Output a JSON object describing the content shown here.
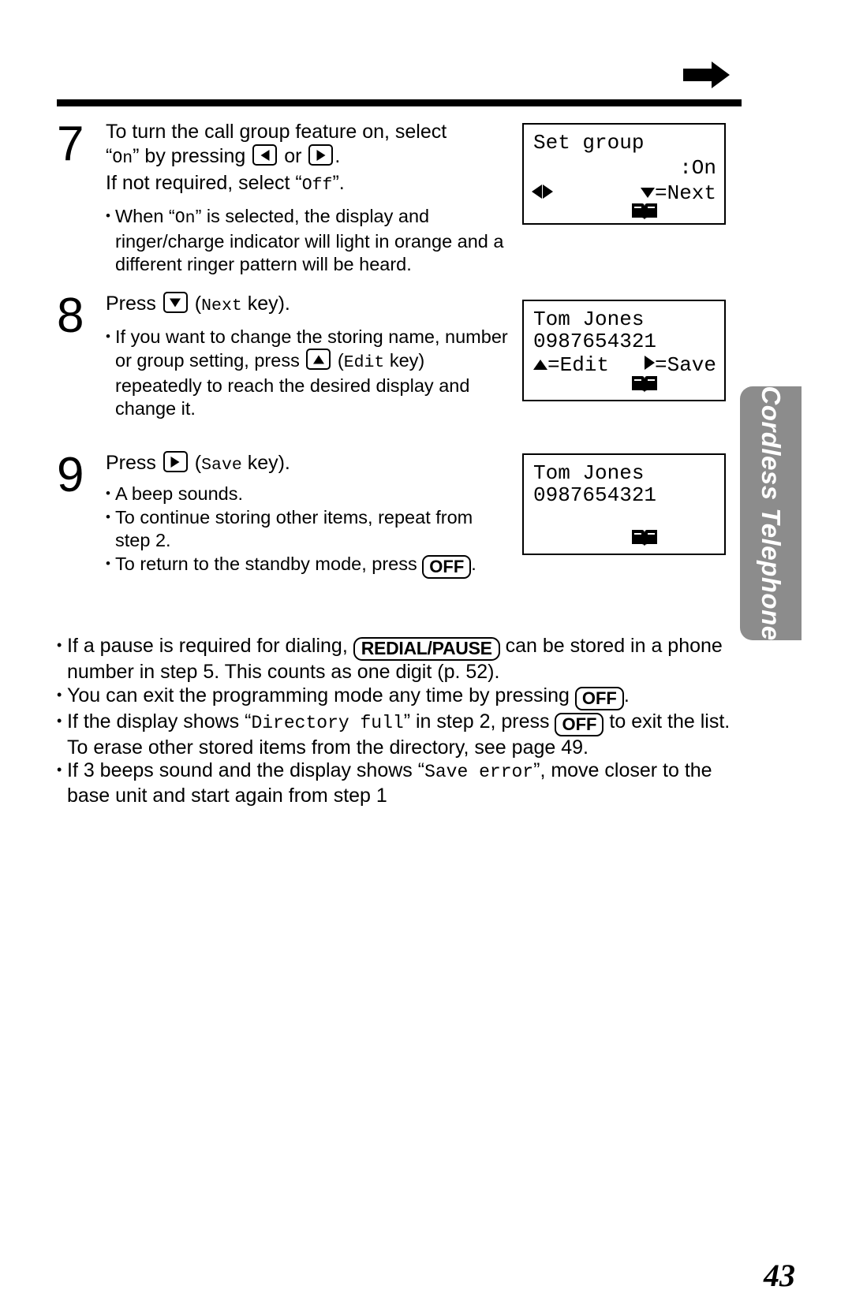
{
  "document": {
    "page_number": "43",
    "side_tab_label": "Cordless Telephone",
    "header_arrow_icon": "right-arrow-icon"
  },
  "steps": [
    {
      "number": "7",
      "lead_part1": "To turn the call group feature on, select",
      "lead_quote_on": "On",
      "lead_part2": "by pressing",
      "lead_or": "or",
      "lead_part3": "If not required, select",
      "lead_quote_off": "Off",
      "bullets": [
        {
          "pre": "When",
          "quoted": "On",
          "post": "is selected, the display and ringer/charge indicator will light in orange and a different ringer pattern will be heard."
        }
      ],
      "keys": [
        "left-arrow-key",
        "right-arrow-key"
      ]
    },
    {
      "number": "8",
      "lead_part1": "Press",
      "lead_key_label": "Next",
      "lead_part2": "key).",
      "bullets": [
        {
          "pre": "If you want to change the storing name, number or group setting, press",
          "key_label": "Edit",
          "post": "key) repeatedly to reach the desired display and change it."
        }
      ],
      "keys": [
        "down-arrow-key",
        "up-arrow-key"
      ]
    },
    {
      "number": "9",
      "lead_part1": "Press",
      "lead_key_label": "Save",
      "lead_part2": "key).",
      "bullets": [
        {
          "text": "A beep sounds."
        },
        {
          "text": "To continue storing other items, repeat from step 2."
        },
        {
          "pre": "To return to the standby mode, press",
          "key_label": "OFF",
          "post": "."
        }
      ],
      "keys": [
        "right-arrow-key"
      ]
    }
  ],
  "lcd_screens": [
    {
      "id": "set-group-screen",
      "line1": "Set group",
      "line2_right": ":On",
      "line3_right": "=Next",
      "left_right_arrows": "left-right-arrows-icon",
      "down_arrow": "down-triangle-icon",
      "book_icon": "open-book-icon"
    },
    {
      "id": "tom-jones-edit-screen",
      "line1": "Tom Jones",
      "line2": "0987654321",
      "line3_left": "=Edit",
      "line3_right": "=Save",
      "up_arrow": "up-triangle-icon",
      "right_arrow": "right-triangle-icon",
      "book_icon": "open-book-icon"
    },
    {
      "id": "tom-jones-saved-screen",
      "line1": "Tom Jones",
      "line2": "0987654321",
      "book_icon": "open-book-icon"
    }
  ],
  "notes": [
    {
      "pre": "If a pause is required for dialing,",
      "key_label": "REDIAL/PAUSE",
      "post": "can be stored in a phone number in step 5. This counts as one digit (p. 52)."
    },
    {
      "pre": "You can exit the programming mode any time by pressing",
      "key_label": "OFF",
      "post": "."
    },
    {
      "pre": "If the display shows",
      "quoted_mono": "Directory full",
      "mid": "in step 2, press",
      "key_label": "OFF",
      "post": "to exit the list. To erase other stored items from the directory, see page 49."
    },
    {
      "pre": "If 3 beeps sound and the display shows",
      "quoted_mono": "Save error",
      "post": ", move closer to the base unit and start again from step 1"
    }
  ],
  "colors": {
    "tab_gray": "#8c8c8c",
    "ink": "#000000",
    "paper": "#ffffff"
  }
}
